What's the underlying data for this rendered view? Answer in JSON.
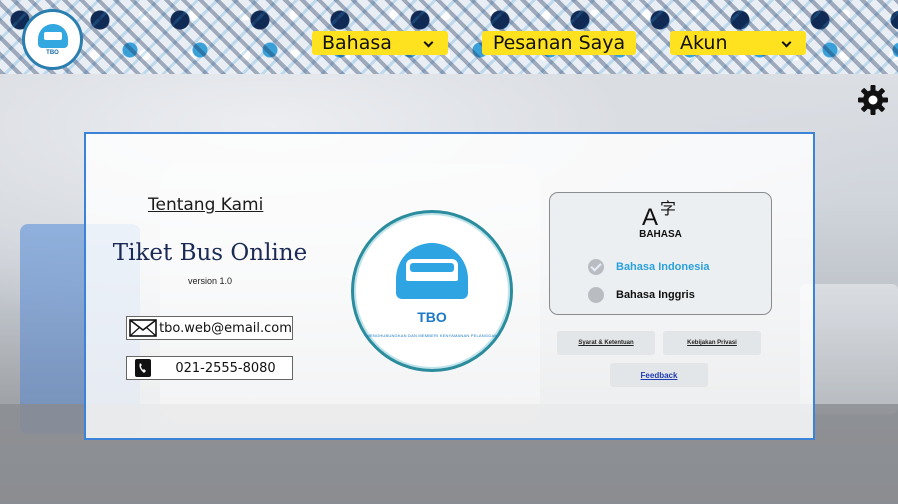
{
  "header": {
    "logo_text": "TBO",
    "nav": {
      "bahasa_label": "Bahasa",
      "pesanan_label": "Pesanan Saya",
      "akun_label": "Akun"
    }
  },
  "settings": {
    "icon": "gear-icon"
  },
  "about": {
    "title": "Tentang Kami",
    "brand": "Tiket Bus Online",
    "version": "version 1.0",
    "email": "tbo.web@email.com",
    "phone": "021-2555-8080"
  },
  "big_logo": {
    "name": "TBO",
    "tagline": "MENGHUBUNGKAN DAN MEMBERI KENYAMANAN PELANGGAN"
  },
  "language": {
    "title": "BAHASA",
    "options": [
      {
        "label": "Bahasa Indonesia",
        "selected": true
      },
      {
        "label": "Bahasa Inggris",
        "selected": false
      }
    ]
  },
  "links": {
    "terms": "Syarat & Ketentuan",
    "privacy": "Kebijakan Privasi",
    "feedback": "Feedback"
  },
  "colors": {
    "nav_yellow": "#ffe21f",
    "panel_border": "#3a83d8",
    "accent_blue": "#2aa1dc",
    "brand_navy": "#1b2a55"
  }
}
